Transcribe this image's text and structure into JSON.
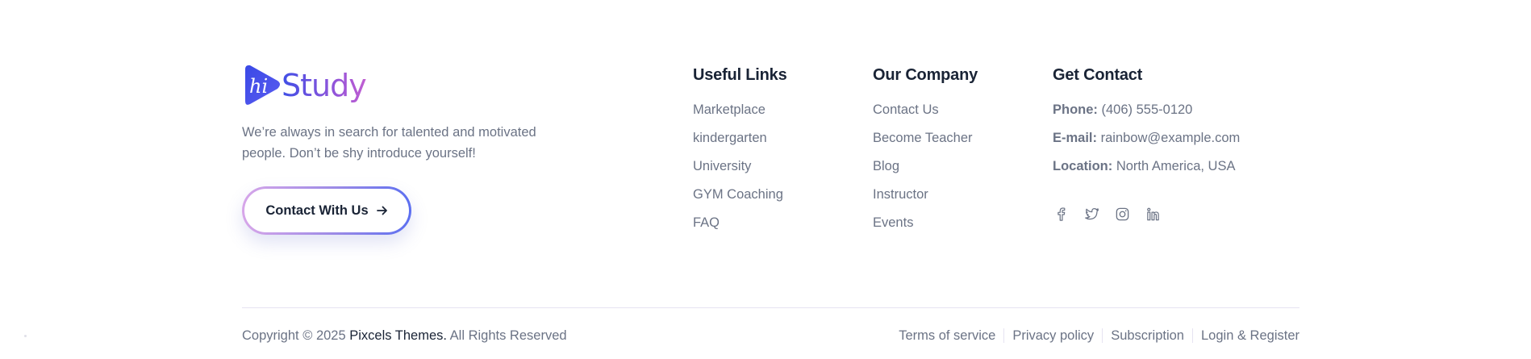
{
  "brand": {
    "logo_mark_text": "hi",
    "name": "Study",
    "tagline": "We’re always in search for talented and motivated people. Don’t be shy introduce yourself!",
    "cta_label": "Contact With Us"
  },
  "useful_links": {
    "heading": "Useful Links",
    "items": [
      "Marketplace",
      "kindergarten",
      "University",
      "GYM Coaching",
      "FAQ"
    ]
  },
  "company": {
    "heading": "Our Company",
    "items": [
      "Contact Us",
      "Become Teacher",
      "Blog",
      "Instructor",
      "Events"
    ]
  },
  "contact": {
    "heading": "Get Contact",
    "phone_label": "Phone:",
    "phone": "(406) 555-0120",
    "email_label": "E-mail:",
    "email": "rainbow@example.com",
    "location_label": "Location:",
    "location": "North America, USA"
  },
  "social": [
    "facebook-icon",
    "twitter-icon",
    "instagram-icon",
    "linkedin-icon"
  ],
  "footer": {
    "copyright_prefix": "Copyright © 2025 ",
    "company": "Pixcels Themes.",
    "rights": " All Rights Reserved",
    "links": [
      "Terms of service",
      "Privacy policy",
      "Subscription",
      "Login & Register"
    ]
  },
  "colors": {
    "heading": "#192335",
    "body": "#6b7385",
    "brand_blue": "#3f4fe6",
    "brand_purple": "#b15cd3"
  }
}
